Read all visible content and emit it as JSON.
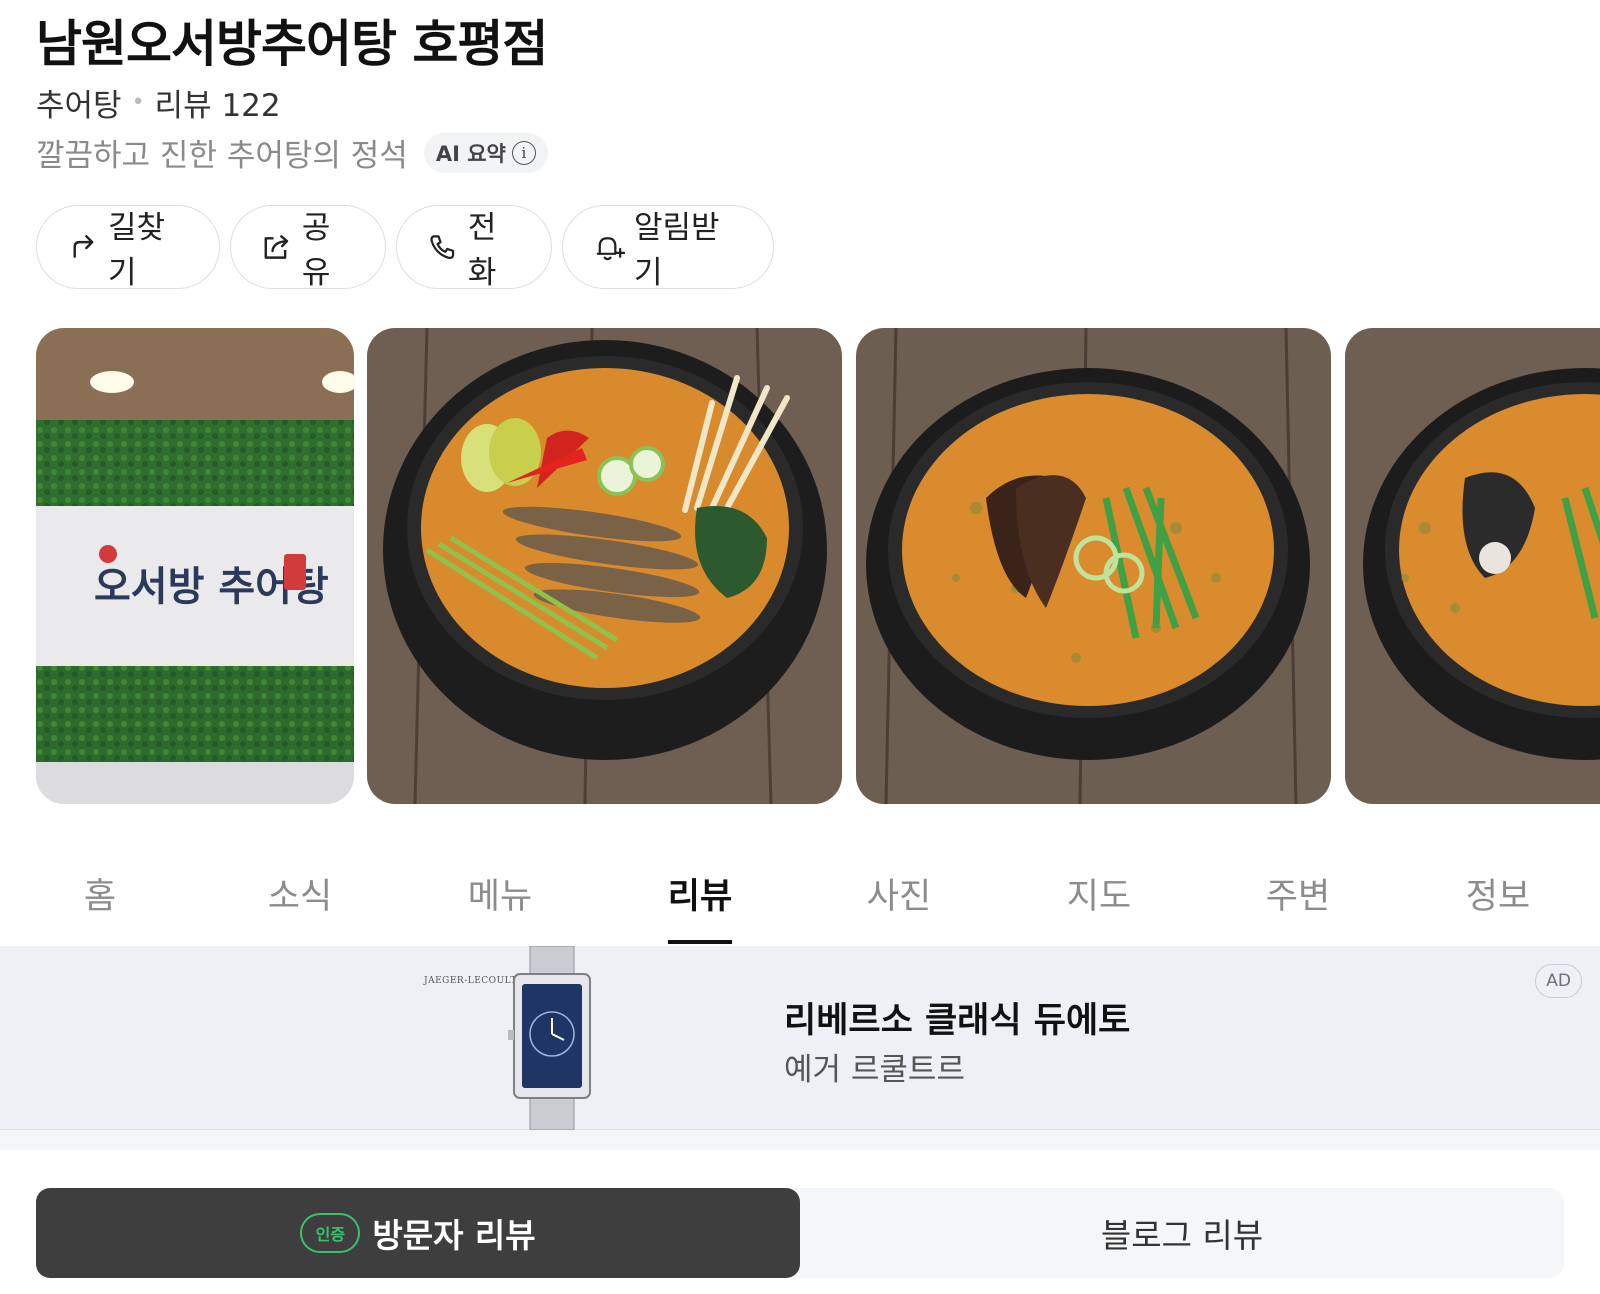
{
  "place": {
    "name": "남원오서방추어탕 호평점",
    "category": "추어탕",
    "reviews_label": "리뷰 122",
    "summary": "깔끔하고 진한 추어탕의 정석",
    "ai_badge": "AI 요약"
  },
  "actions": [
    {
      "label": "길찾기",
      "icon": "directions-icon"
    },
    {
      "label": "공유",
      "icon": "share-icon"
    },
    {
      "label": "전화",
      "icon": "phone-icon"
    },
    {
      "label": "알림받기",
      "icon": "bell-icon"
    }
  ],
  "photos": {
    "sign_text": "오서방 추어탕"
  },
  "tabs": [
    "홈",
    "소식",
    "메뉴",
    "리뷰",
    "사진",
    "지도",
    "주변",
    "정보"
  ],
  "active_tab": "리뷰",
  "ad": {
    "brand": "JAEGER-LECOULTRE",
    "title": "리베르소 클래식 듀에토",
    "subtitle": "예거 르쿨트르",
    "tag": "AD"
  },
  "review_segments": {
    "visitor": "방문자 리뷰",
    "visitor_badge": "인증",
    "blog": "블로그 리뷰"
  },
  "colors": {
    "accent_green": "#39c16c",
    "segment_active": "#3e3e3e",
    "ad_background": "#edf1f5"
  }
}
